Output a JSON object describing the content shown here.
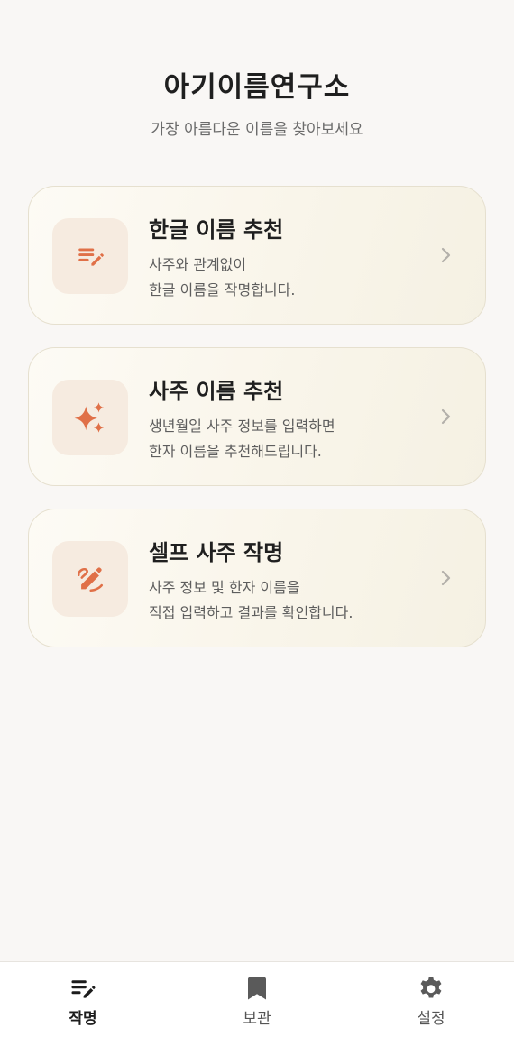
{
  "header": {
    "title": "아기이름연구소",
    "subtitle": "가장 아름다운 이름을 찾아보세요"
  },
  "cards": [
    {
      "title": "한글 이름 추천",
      "desc_line1": "사주와 관계없이",
      "desc_line2": "한글 이름을 작명합니다.",
      "icon": "edit-list-icon"
    },
    {
      "title": "사주 이름 추천",
      "desc_line1": "생년월일 사주 정보를 입력하면",
      "desc_line2": "한자 이름을 추천해드립니다.",
      "icon": "sparkles-icon"
    },
    {
      "title": "셀프 사주 작명",
      "desc_line1": "사주 정보 및 한자 이름을",
      "desc_line2": "직접 입력하고 결과를 확인합니다.",
      "icon": "draw-pencil-icon"
    }
  ],
  "tabs": [
    {
      "label": "작명",
      "icon": "edit-list-icon",
      "active": true
    },
    {
      "label": "보관",
      "icon": "bookmark-icon",
      "active": false
    },
    {
      "label": "설정",
      "icon": "gear-icon",
      "active": false
    }
  ],
  "colors": {
    "accent": "#e07048",
    "icon_bg": "#f6ebe0",
    "card_border": "#e6e0cf",
    "background": "#f9f7f5"
  }
}
